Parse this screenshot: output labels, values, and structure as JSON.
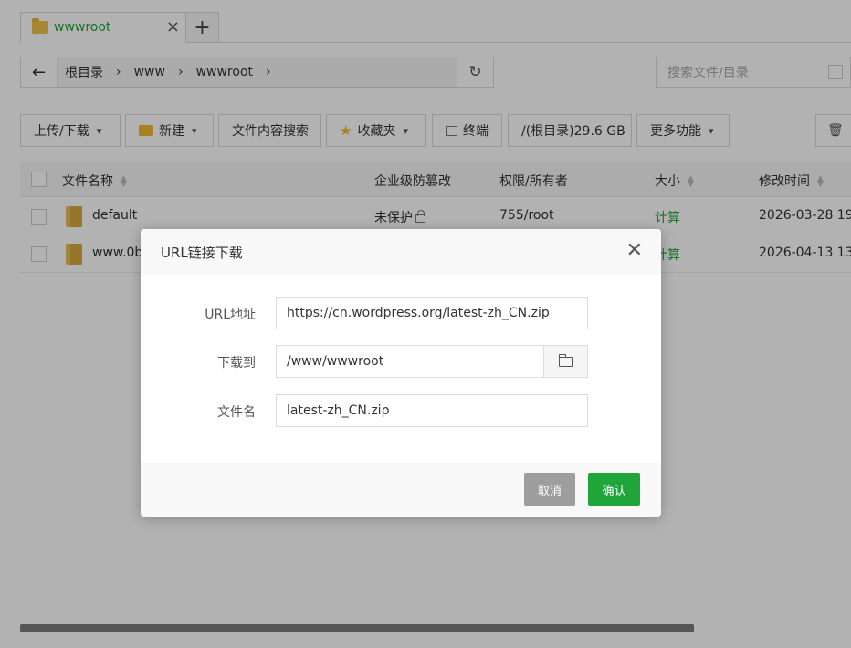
{
  "tabs": [
    {
      "label": "wwwroot",
      "icon": "folder-icon"
    }
  ],
  "path": {
    "crumbs": [
      "根目录",
      "www",
      "wwwroot"
    ],
    "search_placeholder": "搜索文件/目录"
  },
  "toolbar": {
    "upload": "上传/下载",
    "new": "新建",
    "content_search": "文件内容搜索",
    "favorites": "收藏夹",
    "terminal": "终端",
    "disk": "/(根目录)29.6 GB",
    "more": "更多功能"
  },
  "table": {
    "columns": [
      "文件名称",
      "企业级防篡改",
      "权限/所有者",
      "大小",
      "修改时间"
    ],
    "rows": [
      {
        "name": "default",
        "protect": "未保护",
        "perm": "755/root",
        "size": "计算",
        "mtime": "2026-03-28 19:"
      },
      {
        "name": "www.0b",
        "protect": "",
        "perm": "",
        "size": "计算",
        "mtime": "2026-04-13 13:"
      }
    ]
  },
  "modal": {
    "title": "URL链接下载",
    "url_label": "URL地址",
    "url_value": "https://cn.wordpress.org/latest-zh_CN.zip",
    "dir_label": "下载到",
    "dir_value": "/www/wwwroot",
    "filename_label": "文件名",
    "filename_value": "latest-zh_CN.zip",
    "cancel": "取消",
    "confirm": "确认"
  },
  "colors": {
    "accent": "#20a53a",
    "cancel": "#9e9e9e",
    "folder": "#f0c24b"
  }
}
